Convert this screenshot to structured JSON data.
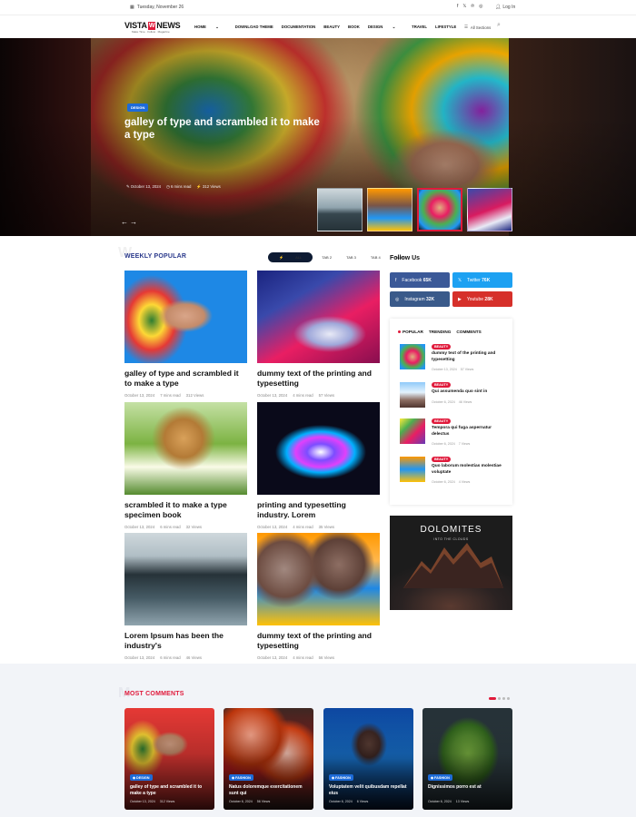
{
  "topbar": {
    "date": "Tuesday, November 26",
    "social": [
      "f",
      "𝕏",
      "℗",
      "◎"
    ],
    "login": "Log In"
  },
  "header": {
    "logo_a": "VISTA",
    "logo_box": "W",
    "logo_b": "NEWS",
    "tagline": "Make Time · Follow · Magazine",
    "nav": [
      "HOME",
      "DOWNLOAD THEME",
      "DOCUMENTATION",
      "BEAUTY",
      "BOOK",
      "DESIGN",
      "TRAVEL",
      "LIFESTYLE"
    ],
    "nav_dropdowns": [
      0,
      5
    ],
    "all_sections": "All Sections"
  },
  "hero": {
    "category": "DESIGN",
    "title": "galley of type and scrambled it to make a type",
    "date": "October 13, 2024",
    "read": "6 mins read",
    "views": "312 Views"
  },
  "weekly": {
    "title": "WEEKLY POPULAR",
    "ghost": "W",
    "tabs": [
      "ALL",
      "TAB 2",
      "TAB 3",
      "TAB 4",
      "TAB 5"
    ],
    "cards": [
      {
        "title": "galley of type and scrambled it to make a type",
        "date": "October 13, 2024",
        "read": "7 mins read",
        "views": "312 Views"
      },
      {
        "title": "dummy text of the printing and typesetting",
        "date": "October 13, 2024",
        "read": "4 mins read",
        "views": "57 Views"
      },
      {
        "title": "scrambled it to make a type specimen book",
        "date": "October 13, 2024",
        "read": "6 mins read",
        "views": "32 Views"
      },
      {
        "title": "printing and typesetting industry. Lorem",
        "date": "October 13, 2024",
        "read": "4 mins read",
        "views": "35 Views"
      },
      {
        "title": "Lorem Ipsum has been the industry's",
        "date": "October 13, 2024",
        "read": "6 mins read",
        "views": "46 Views"
      },
      {
        "title": "dummy text of the printing and typesetting",
        "date": "October 13, 2024",
        "read": "4 mins read",
        "views": "56 Views"
      }
    ]
  },
  "follow": {
    "title": "Follow Us",
    "buttons": [
      {
        "label": "Facebook",
        "count": "65K",
        "icon": "f"
      },
      {
        "label": "Twitter",
        "count": "76K",
        "icon": "𝕏"
      },
      {
        "label": "Instagram",
        "count": "32K",
        "icon": "◎"
      },
      {
        "label": "Youtube",
        "count": "28K",
        "icon": "▶"
      }
    ]
  },
  "popular": {
    "tabs": [
      "POPULAR",
      "TRENDING",
      "COMMENTS"
    ],
    "items": [
      {
        "badge": "BEAUTY",
        "title": "dummy text of the printing and typesetting",
        "date": "October 13, 2024",
        "views": "57 Views"
      },
      {
        "badge": "BEAUTY",
        "title": "Qui assumenda quo sint in",
        "date": "October 6, 2024",
        "views": "46 Views"
      },
      {
        "badge": "BEAUTY",
        "title": "Tempora qui fuga aspernatur delectus",
        "date": "October 6, 2024",
        "views": "7 Views"
      },
      {
        "badge": "BEAUTY",
        "title": "Quo laborum molestias molestiae voluptate",
        "date": "October 6, 2024",
        "views": "4 Views"
      }
    ]
  },
  "ad": {
    "title": "DOLOMITES",
    "subtitle": "INTO THE CLOUDS"
  },
  "most_comments": {
    "title": "MOST COMMENTS",
    "ghost": "M",
    "cards": [
      {
        "category": "DESIGN",
        "title": "galley of type and scrambled it to make a type",
        "date": "October 13, 2024",
        "views": "312 Views"
      },
      {
        "category": "FASHION",
        "title": "Natus doloremque exercitationem sunt qui",
        "date": "October 6, 2024",
        "views": "56 Views"
      },
      {
        "category": "FASHION",
        "title": "Voluptatem velit quibusdam repellat eius",
        "date": "October 6, 2024",
        "views": "6 Views"
      },
      {
        "category": "FASHION",
        "title": "Dignissimos porro est at",
        "date": "October 6, 2024",
        "views": "13 Views"
      }
    ]
  },
  "colors": {
    "accent": "#e01a3b",
    "blue": "#1d6bd8",
    "navy": "#0e1b33",
    "facebook": "#3b5998",
    "twitter": "#1da1f2",
    "instagram": "#3a5a8a",
    "youtube": "#d6302a"
  }
}
